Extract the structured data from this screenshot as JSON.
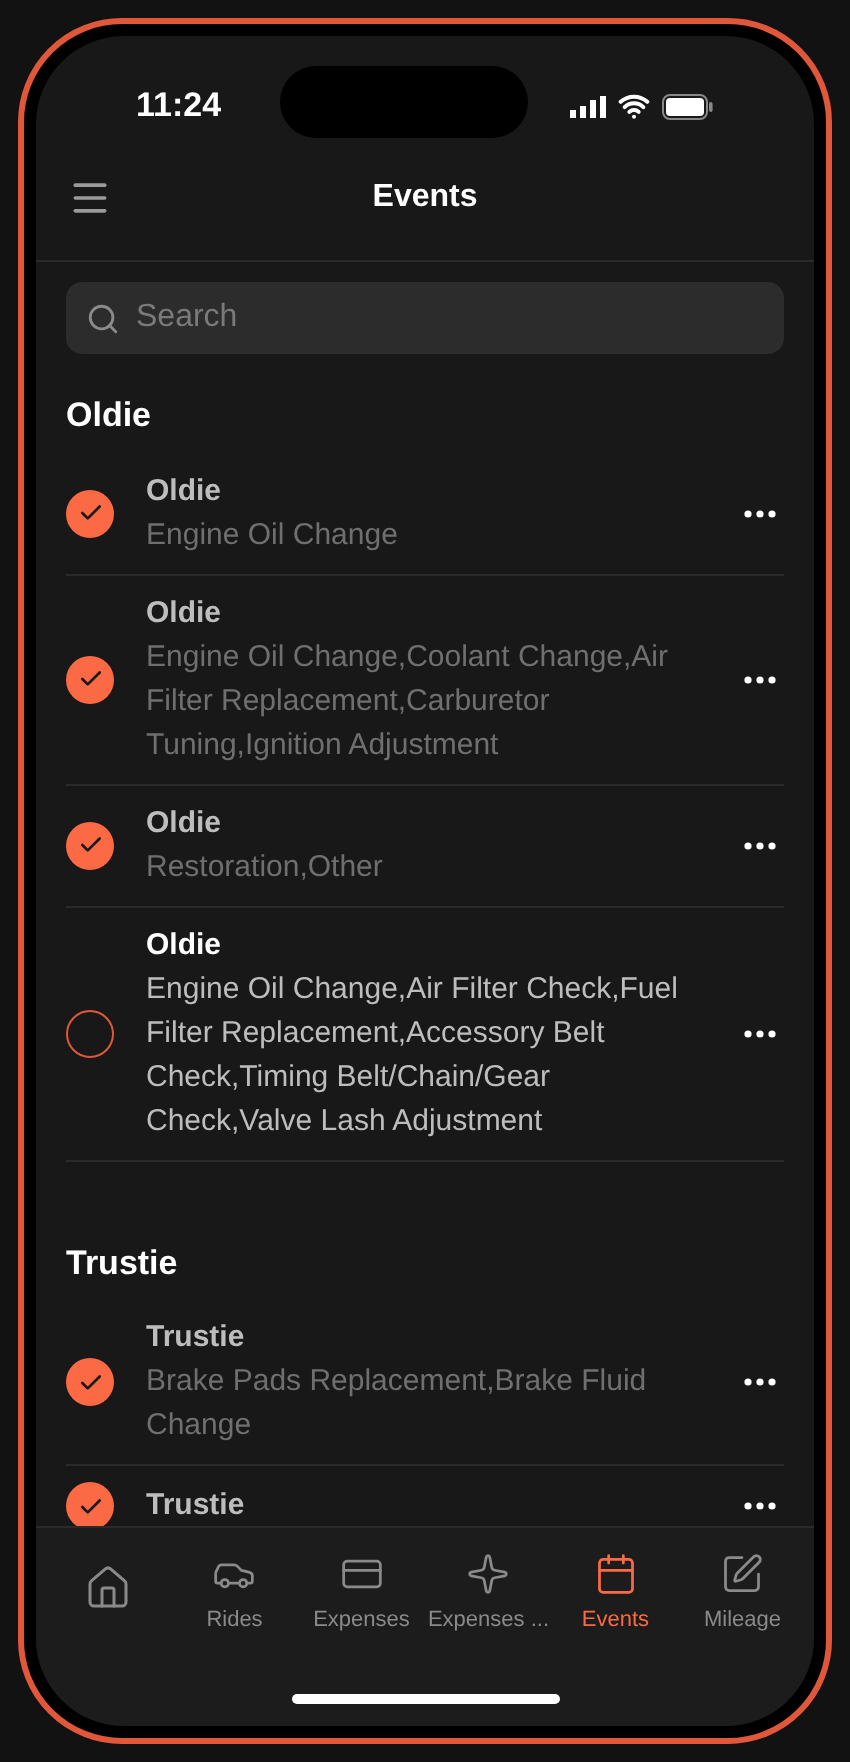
{
  "status_bar": {
    "time": "11:24"
  },
  "header": {
    "title": "Events"
  },
  "search": {
    "placeholder": "Search"
  },
  "groups": [
    {
      "title": "Oldie",
      "events": [
        {
          "title": "Oldie",
          "description": "Engine Oil Change",
          "checked": true
        },
        {
          "title": "Oldie",
          "description": "Engine Oil Change,Coolant Change,Air Filter Replacement,Carburetor Tuning,Ignition Adjustment",
          "checked": true
        },
        {
          "title": "Oldie",
          "description": "Restoration,Other",
          "checked": true
        },
        {
          "title": "Oldie",
          "description": "Engine Oil Change,Air Filter Check,Fuel Filter Replacement,Accessory Belt Check,Timing Belt/Chain/Gear Check,Valve Lash Adjustment",
          "checked": false
        }
      ]
    },
    {
      "title": "Trustie",
      "events": [
        {
          "title": "Trustie",
          "description": "Brake Pads Replacement,Brake Fluid Change",
          "checked": true
        },
        {
          "title": "Trustie",
          "checked": true
        }
      ]
    }
  ],
  "tab_bar": [
    {
      "kind": "home",
      "selected": false
    },
    {
      "kind": "car",
      "label": "Rides",
      "selected": false
    },
    {
      "kind": "card",
      "label": "Expenses",
      "selected": false
    },
    {
      "kind": "sparkle",
      "label": "Expenses ...",
      "selected": false
    },
    {
      "kind": "calendar",
      "label": "Events",
      "selected": true
    },
    {
      "kind": "pencil",
      "label": "Mileage",
      "selected": false
    }
  ]
}
